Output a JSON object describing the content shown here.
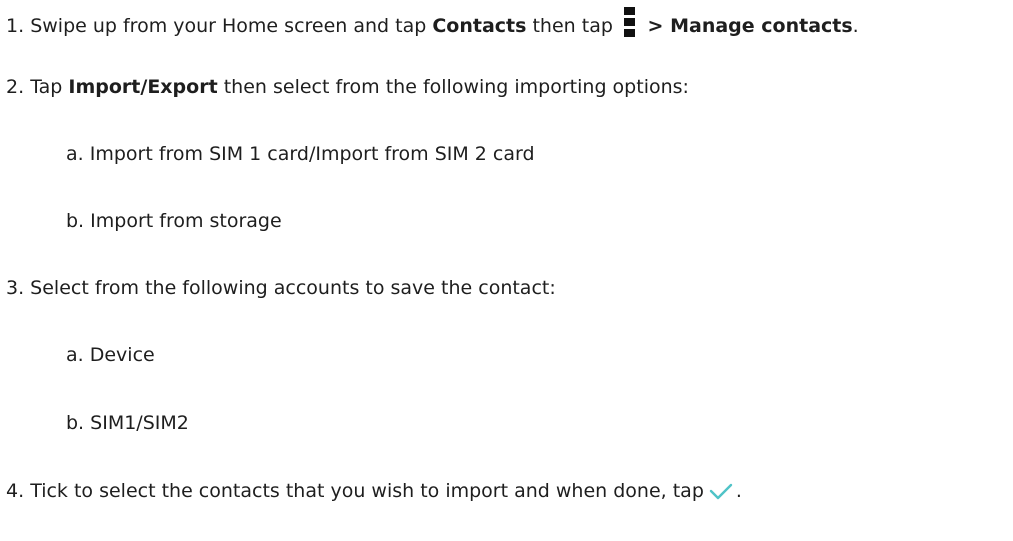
{
  "steps": [
    {
      "number": "1.",
      "text_before": "Swipe up from your Home screen and tap ",
      "bold_1": "Contacts",
      "text_middle": " then tap ",
      "icon": "more-vert-icon",
      "bold_2": " > Manage contacts",
      "text_after": "."
    },
    {
      "number": "2.",
      "text_before": "Tap ",
      "bold_1": "Import/Export",
      "text_after": " then select from the following importing options:",
      "subitems": [
        {
          "letter": "a.",
          "text": "Import from SIM 1 card/Import from SIM 2 card"
        },
        {
          "letter": "b.",
          "text": "Import from storage"
        }
      ]
    },
    {
      "number": "3.",
      "text": " Select from the following accounts to save the contact:",
      "subitems": [
        {
          "letter": "a.",
          "text": "Device"
        },
        {
          "letter": "b.",
          "text": "SIM1/SIM2"
        }
      ]
    },
    {
      "number": "4.",
      "text_before": "Tick to select the contacts that you wish to import and when done, tap",
      "icon": "checkmark-icon",
      "icon_color": "#4fc3c7",
      "text_after": "."
    }
  ]
}
